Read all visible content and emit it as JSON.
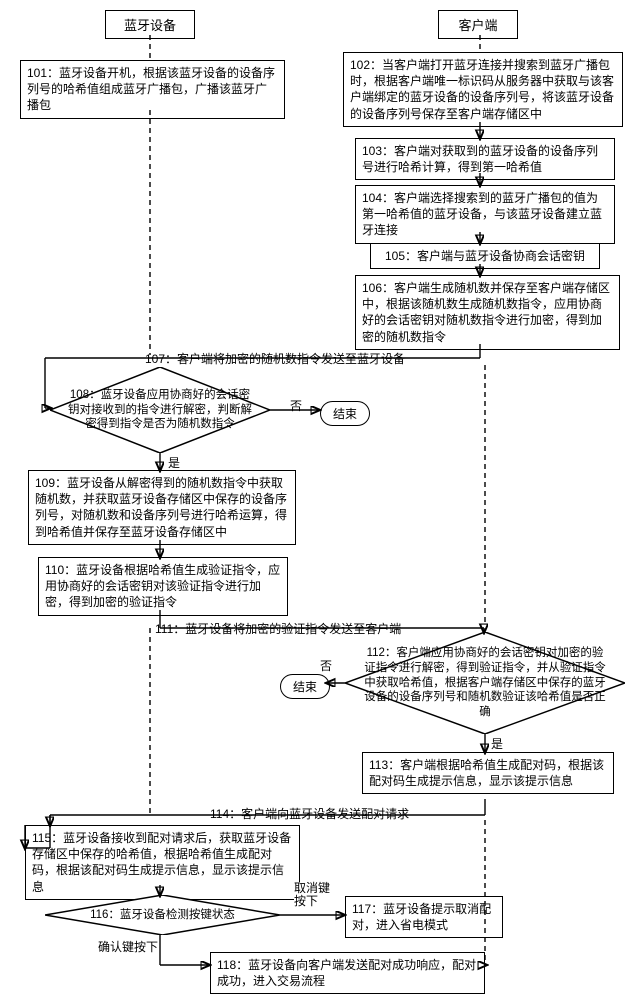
{
  "headers": {
    "left": "蓝牙设备",
    "right": "客户端"
  },
  "steps": {
    "s101": "101：蓝牙设备开机，根据该蓝牙设备的设备序列号的哈希值组成蓝牙广播包，广播该蓝牙广播包",
    "s102": "102：当客户端打开蓝牙连接并搜索到蓝牙广播包时，根据客户端唯一标识码从服务器中获取与该客户端绑定的蓝牙设备的设备序列号，将该蓝牙设备的设备序列号保存至客户端存储区中",
    "s103": "103：客户端对获取到的蓝牙设备的设备序列号进行哈希计算，得到第一哈希值",
    "s104": "104：客户端选择搜索到的蓝牙广播包的值为第一哈希值的蓝牙设备，与该蓝牙设备建立蓝牙连接",
    "s105": "105：客户端与蓝牙设备协商会话密钥",
    "s106": "106：客户端生成随机数并保存至客户端存储区中，根据该随机数生成随机数指令，应用协商好的会话密钥对随机数指令进行加密，得到加密的随机数指令",
    "s107": "107：客户端将加密的随机数指令发送至蓝牙设备",
    "s108": "108：蓝牙设备应用协商好的会话密钥对接收到的指令进行解密，判断解密得到指令是否为随机数指令",
    "s109": "109：蓝牙设备从解密得到的随机数指令中获取随机数，并获取蓝牙设备存储区中保存的设备序列号，对随机数和设备序列号进行哈希运算，得到哈希值并保存至蓝牙设备存储区中",
    "s110": "110：蓝牙设备根据哈希值生成验证指令，应用协商好的会话密钥对该验证指令进行加密，得到加密的验证指令",
    "s111": "111：蓝牙设备将加密的验证指令发送至客户端",
    "s112": "112：客户端应用协商好的会话密钥对加密的验证指令进行解密，得到验证指令，并从验证指令中获取哈希值，根据客户端存储区中保存的蓝牙设备的设备序列号和随机数验证该哈希值是否正确",
    "s113": "113：客户端根据哈希值生成配对码，根据该配对码生成提示信息，显示该提示信息",
    "s114": "114：客户端向蓝牙设备发送配对请求",
    "s115": "115：蓝牙设备接收到配对请求后，获取蓝牙设备存储区中保存的哈希值，根据哈希值生成配对码，根据该配对码生成提示信息，显示该提示信息",
    "s116": "116：蓝牙设备检测按键状态",
    "s117": "117：蓝牙设备提示取消配对，进入省电模式",
    "s118": "118：蓝牙设备向客户端发送配对成功响应，配对成功，进入交易流程"
  },
  "labels": {
    "yes": "是",
    "no": "否",
    "end": "结束",
    "cancel_key": "取消键按下",
    "confirm_key": "确认键按下"
  }
}
